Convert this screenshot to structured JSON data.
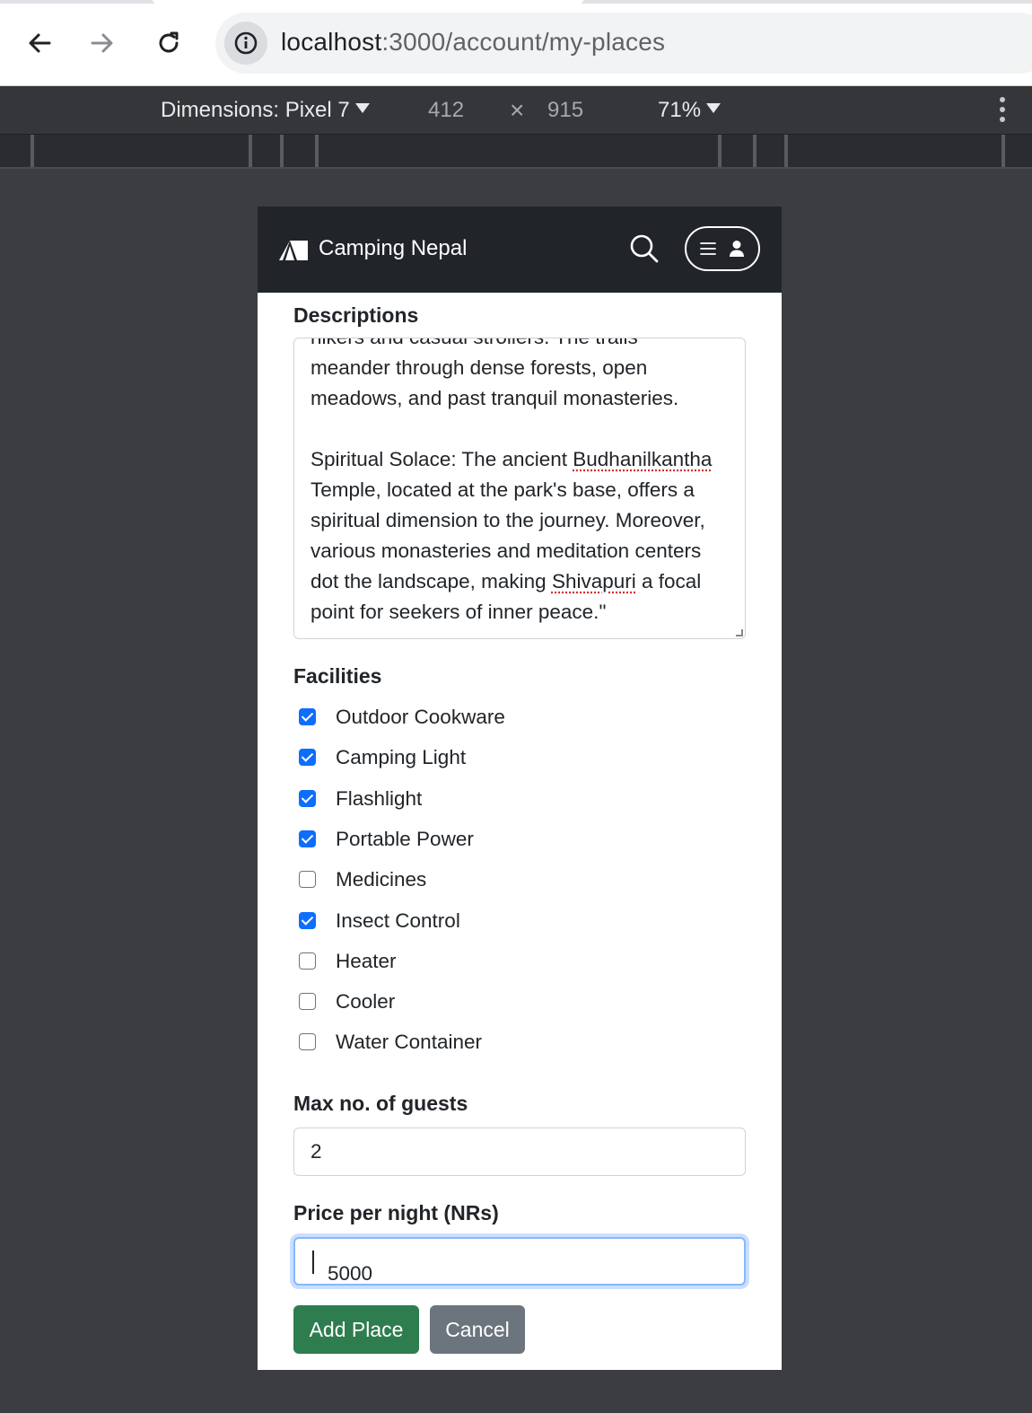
{
  "browser": {
    "url_host": "localhost",
    "url_path": ":3000/account/my-places"
  },
  "device_toolbar": {
    "dimensions_label": "Dimensions: Pixel 7",
    "width": "412",
    "times": "×",
    "height": "915",
    "zoom": "71%"
  },
  "navbar": {
    "brand": "Camping Nepal"
  },
  "form": {
    "descriptions_label": "Descriptions",
    "descriptions_value": "hikers and casual strollers. The trails meander through dense forests, open meadows, and past tranquil monasteries.\n\nSpiritual Solace: The ancient Budhanilkantha Temple, located at the park's base, offers a spiritual dimension to the journey. Moreover, various monasteries and meditation centers dot the landscape, making Shivapuri a focal point for seekers of inner peace.\"",
    "desc_lines": [
      "hikers and casual strollers. The trails",
      "meander through dense forests, open",
      "meadows, and past tranquil monasteries.",
      "",
      "Spiritual Solace: The ancient ",
      "Budhanilkantha",
      "Temple, located at the park's base, offers a",
      "spiritual dimension to the journey. Moreover,",
      "various monasteries and meditation centers",
      "dot the landscape, making ",
      "Shivapuri",
      " a focal",
      "point for seekers of inner peace.\""
    ],
    "facilities_label": "Facilities",
    "facilities": [
      {
        "label": "Outdoor Cookware",
        "checked": true
      },
      {
        "label": "Camping Light",
        "checked": true
      },
      {
        "label": "Flashlight",
        "checked": true
      },
      {
        "label": "Portable Power",
        "checked": true
      },
      {
        "label": "Medicines",
        "checked": false
      },
      {
        "label": "Insect Control",
        "checked": true
      },
      {
        "label": "Heater",
        "checked": false
      },
      {
        "label": "Cooler",
        "checked": false
      },
      {
        "label": "Water Container",
        "checked": false
      }
    ],
    "guests_label": "Max no. of guests",
    "guests_value": "2",
    "price_label": "Price per night (NRs)",
    "price_value": "5000",
    "add_button": "Add Place",
    "cancel_button": "Cancel"
  },
  "colors": {
    "navbar_bg": "#212529",
    "checkbox_checked": "#0d6efd",
    "add_button": "#2e7d4f",
    "cancel_button": "#6c757d",
    "focus_ring": "#86b7fe"
  }
}
